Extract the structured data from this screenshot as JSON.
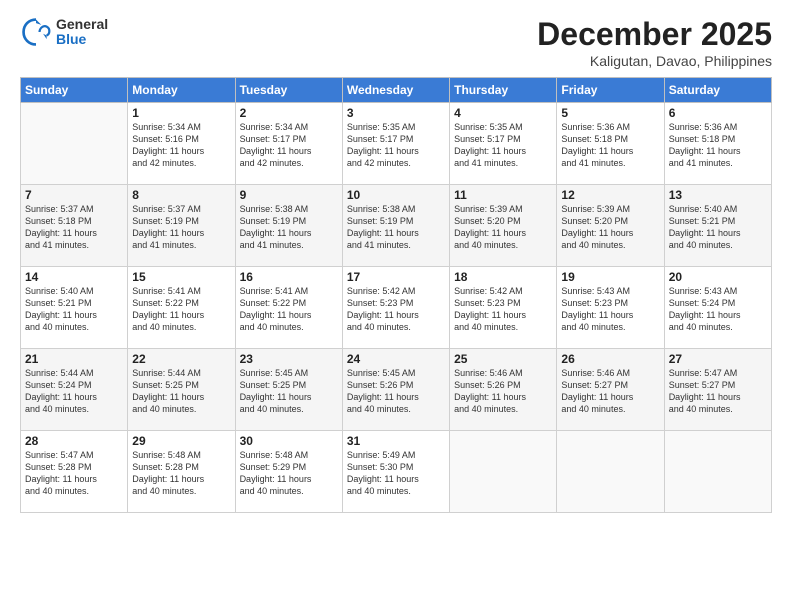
{
  "logo": {
    "general": "General",
    "blue": "Blue"
  },
  "header": {
    "month": "December 2025",
    "location": "Kaligutan, Davao, Philippines"
  },
  "weekdays": [
    "Sunday",
    "Monday",
    "Tuesday",
    "Wednesday",
    "Thursday",
    "Friday",
    "Saturday"
  ],
  "weeks": [
    [
      {
        "day": "",
        "info": ""
      },
      {
        "day": "1",
        "info": "Sunrise: 5:34 AM\nSunset: 5:16 PM\nDaylight: 11 hours\nand 42 minutes."
      },
      {
        "day": "2",
        "info": "Sunrise: 5:34 AM\nSunset: 5:17 PM\nDaylight: 11 hours\nand 42 minutes."
      },
      {
        "day": "3",
        "info": "Sunrise: 5:35 AM\nSunset: 5:17 PM\nDaylight: 11 hours\nand 42 minutes."
      },
      {
        "day": "4",
        "info": "Sunrise: 5:35 AM\nSunset: 5:17 PM\nDaylight: 11 hours\nand 41 minutes."
      },
      {
        "day": "5",
        "info": "Sunrise: 5:36 AM\nSunset: 5:18 PM\nDaylight: 11 hours\nand 41 minutes."
      },
      {
        "day": "6",
        "info": "Sunrise: 5:36 AM\nSunset: 5:18 PM\nDaylight: 11 hours\nand 41 minutes."
      }
    ],
    [
      {
        "day": "7",
        "info": "Sunrise: 5:37 AM\nSunset: 5:18 PM\nDaylight: 11 hours\nand 41 minutes."
      },
      {
        "day": "8",
        "info": "Sunrise: 5:37 AM\nSunset: 5:19 PM\nDaylight: 11 hours\nand 41 minutes."
      },
      {
        "day": "9",
        "info": "Sunrise: 5:38 AM\nSunset: 5:19 PM\nDaylight: 11 hours\nand 41 minutes."
      },
      {
        "day": "10",
        "info": "Sunrise: 5:38 AM\nSunset: 5:19 PM\nDaylight: 11 hours\nand 41 minutes."
      },
      {
        "day": "11",
        "info": "Sunrise: 5:39 AM\nSunset: 5:20 PM\nDaylight: 11 hours\nand 40 minutes."
      },
      {
        "day": "12",
        "info": "Sunrise: 5:39 AM\nSunset: 5:20 PM\nDaylight: 11 hours\nand 40 minutes."
      },
      {
        "day": "13",
        "info": "Sunrise: 5:40 AM\nSunset: 5:21 PM\nDaylight: 11 hours\nand 40 minutes."
      }
    ],
    [
      {
        "day": "14",
        "info": "Sunrise: 5:40 AM\nSunset: 5:21 PM\nDaylight: 11 hours\nand 40 minutes."
      },
      {
        "day": "15",
        "info": "Sunrise: 5:41 AM\nSunset: 5:22 PM\nDaylight: 11 hours\nand 40 minutes."
      },
      {
        "day": "16",
        "info": "Sunrise: 5:41 AM\nSunset: 5:22 PM\nDaylight: 11 hours\nand 40 minutes."
      },
      {
        "day": "17",
        "info": "Sunrise: 5:42 AM\nSunset: 5:23 PM\nDaylight: 11 hours\nand 40 minutes."
      },
      {
        "day": "18",
        "info": "Sunrise: 5:42 AM\nSunset: 5:23 PM\nDaylight: 11 hours\nand 40 minutes."
      },
      {
        "day": "19",
        "info": "Sunrise: 5:43 AM\nSunset: 5:23 PM\nDaylight: 11 hours\nand 40 minutes."
      },
      {
        "day": "20",
        "info": "Sunrise: 5:43 AM\nSunset: 5:24 PM\nDaylight: 11 hours\nand 40 minutes."
      }
    ],
    [
      {
        "day": "21",
        "info": "Sunrise: 5:44 AM\nSunset: 5:24 PM\nDaylight: 11 hours\nand 40 minutes."
      },
      {
        "day": "22",
        "info": "Sunrise: 5:44 AM\nSunset: 5:25 PM\nDaylight: 11 hours\nand 40 minutes."
      },
      {
        "day": "23",
        "info": "Sunrise: 5:45 AM\nSunset: 5:25 PM\nDaylight: 11 hours\nand 40 minutes."
      },
      {
        "day": "24",
        "info": "Sunrise: 5:45 AM\nSunset: 5:26 PM\nDaylight: 11 hours\nand 40 minutes."
      },
      {
        "day": "25",
        "info": "Sunrise: 5:46 AM\nSunset: 5:26 PM\nDaylight: 11 hours\nand 40 minutes."
      },
      {
        "day": "26",
        "info": "Sunrise: 5:46 AM\nSunset: 5:27 PM\nDaylight: 11 hours\nand 40 minutes."
      },
      {
        "day": "27",
        "info": "Sunrise: 5:47 AM\nSunset: 5:27 PM\nDaylight: 11 hours\nand 40 minutes."
      }
    ],
    [
      {
        "day": "28",
        "info": "Sunrise: 5:47 AM\nSunset: 5:28 PM\nDaylight: 11 hours\nand 40 minutes."
      },
      {
        "day": "29",
        "info": "Sunrise: 5:48 AM\nSunset: 5:28 PM\nDaylight: 11 hours\nand 40 minutes."
      },
      {
        "day": "30",
        "info": "Sunrise: 5:48 AM\nSunset: 5:29 PM\nDaylight: 11 hours\nand 40 minutes."
      },
      {
        "day": "31",
        "info": "Sunrise: 5:49 AM\nSunset: 5:30 PM\nDaylight: 11 hours\nand 40 minutes."
      },
      {
        "day": "",
        "info": ""
      },
      {
        "day": "",
        "info": ""
      },
      {
        "day": "",
        "info": ""
      }
    ]
  ]
}
